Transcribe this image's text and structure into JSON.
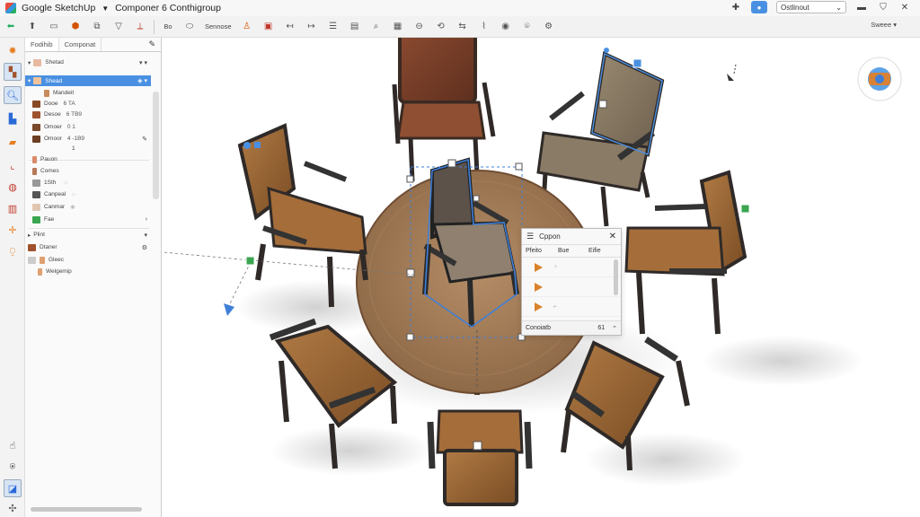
{
  "window": {
    "app_title": "Google SketchUp",
    "doc_title": "Componer 6  Conthigroup",
    "select_value": "Ostlinout",
    "right_label": "Sweee"
  },
  "toolbar": {
    "label_a": "Bo",
    "label_b": "Sennose"
  },
  "outliner": {
    "tab_1": "Fodihib",
    "tab_2": "Componat",
    "rows": [
      {
        "label": "Shetad"
      },
      {
        "label": "Shead"
      },
      {
        "label": "Mandeit"
      },
      {
        "label": "Dooe",
        "value": "6 TA"
      },
      {
        "label": "Desoe",
        "value": "6 TB9"
      },
      {
        "label": "Omoer",
        "value": "0 1"
      },
      {
        "label": "Omoor",
        "value": "4 -1B9"
      },
      {
        "label": "",
        "value": "1"
      },
      {
        "label": "Pauon"
      },
      {
        "label": "Comes"
      },
      {
        "label": "1Sth"
      },
      {
        "label": "Canpeal"
      },
      {
        "label": "Canmar"
      },
      {
        "label": "Fae"
      },
      {
        "label": "Plint"
      },
      {
        "label": "Dtaner"
      },
      {
        "label": "Gleec"
      },
      {
        "label": "Welgemip"
      }
    ]
  },
  "dialog": {
    "title": "Cppon",
    "col_1": "Pfeito",
    "col_2": "Bue",
    "col_3": "Eifie",
    "foot_label": "Conoiatb",
    "foot_num": "61"
  },
  "colors": {
    "accent": "#4a90e2",
    "selection": "#3f7fd8",
    "wood_table": "#a9815d",
    "leather_brown": "#8a5a2f"
  }
}
